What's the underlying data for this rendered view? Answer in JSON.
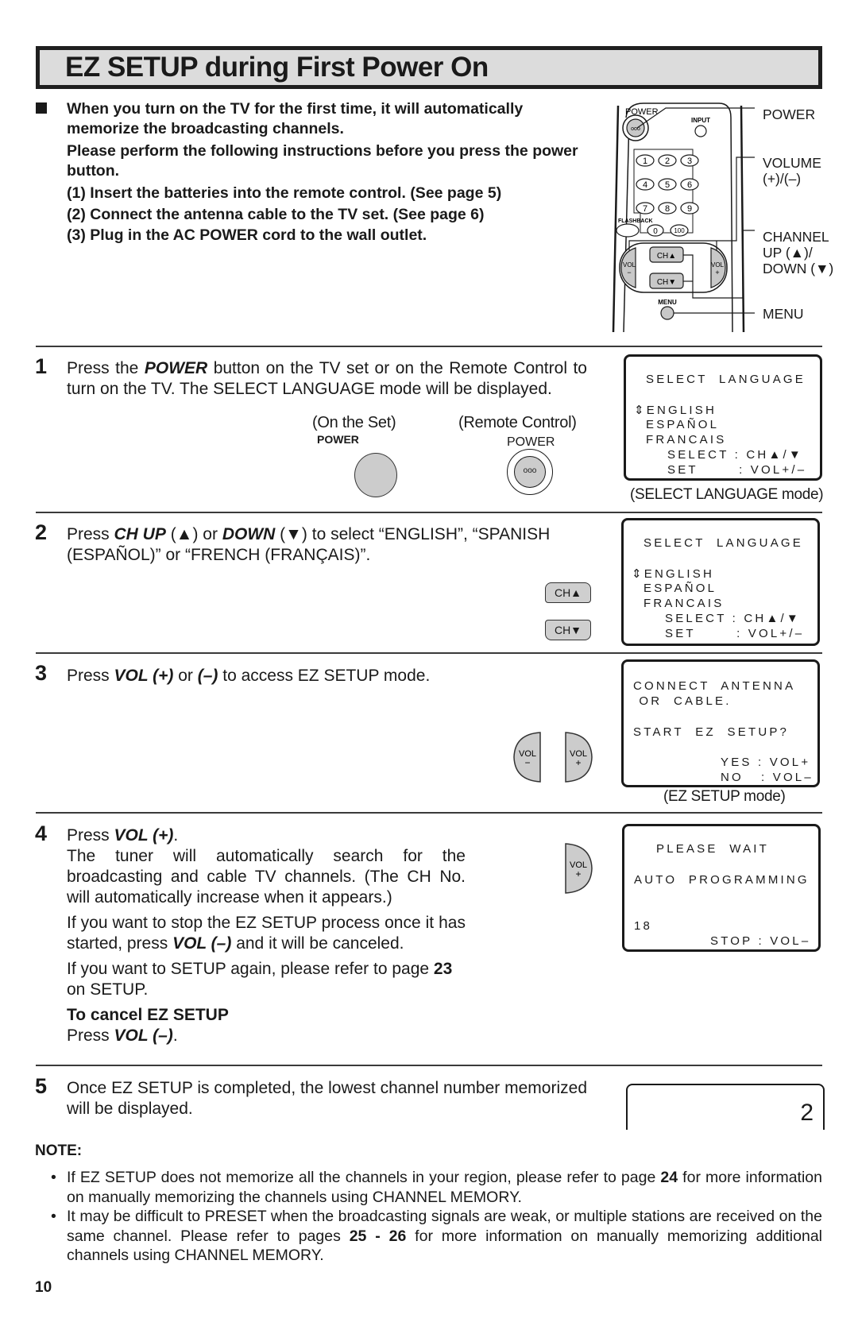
{
  "page": {
    "title": "EZ SETUP during First Power On",
    "page_number": "10"
  },
  "intro": {
    "paragraph1": "When you turn on the TV for the first time, it will automatically memorize the broadcasting channels.",
    "paragraph2": "Please perform the following instructions before you press the power button.",
    "items": [
      "(1) Insert the batteries into the remote control. (See page 5)",
      "(2) Connect the antenna cable to the TV set.  (See page 6)",
      "(3) Plug in the AC POWER cord to the wall outlet."
    ]
  },
  "remote": {
    "buttons": {
      "power": "POWER",
      "input": "INPUT",
      "digits": [
        "1",
        "2",
        "3",
        "4",
        "5",
        "6",
        "7",
        "8",
        "9"
      ],
      "flashback": "FLASHBACK",
      "zero": "0",
      "hundred": "100",
      "ch_up": "CH▲",
      "ch_down": "CH▼",
      "vol_minus": "VOL −",
      "vol_plus": "VOL +",
      "menu": "MENU"
    },
    "callouts": {
      "power": "POWER",
      "volume_line1": "VOLUME",
      "volume_line2": "(+)/(–)",
      "channel_line1": "CHANNEL",
      "channel_line2": "UP (▲)/",
      "channel_line3": "DOWN (▼)",
      "menu": "MENU"
    }
  },
  "steps": [
    {
      "number": "1",
      "text_pre": "Press the ",
      "text_em": "POWER",
      "text_post": " button on the TV set or on the Remote Control to turn on the TV. The SELECT LANGUAGE mode will be displayed.",
      "on_set_caption": "(On the Set)",
      "on_set_label": "POWER",
      "remote_caption": "(Remote Control)",
      "remote_label": "POWER",
      "osd": {
        "lines": [
          "SELECT  LANGUAGE",
          "⇕ENGLISH",
          "ESPAÑOL",
          "FRANCAIS",
          "SELECT : CH▲/▼",
          "SET       : VOL+/–"
        ]
      },
      "osd_caption": "(SELECT LANGUAGE mode)"
    },
    {
      "number": "2",
      "text_pre": "Press ",
      "text_em1": "CH UP",
      "text_mid1": " (▲) or ",
      "text_em2": "DOWN",
      "text_post": " (▼) to select “ENGLISH”, “SPANISH (ESPAÑOL)” or “FRENCH (FRANÇAIS)”.",
      "button_up": "CH▲",
      "button_down": "CH▼",
      "osd": {
        "lines": [
          "SELECT  LANGUAGE",
          "⇕ENGLISH",
          "ESPAÑOL",
          "FRANCAIS",
          "SELECT : CH▲/▼",
          "SET       : VOL+/–"
        ]
      }
    },
    {
      "number": "3",
      "text_pre": "Press ",
      "text_em1": "VOL (+)",
      "text_mid": " or ",
      "text_em2": "(–)",
      "text_post": " to access EZ SETUP mode.",
      "button_minus": "VOL\n−",
      "button_plus": "VOL\n+",
      "osd": {
        "lines": [
          "CONNECT  ANTENNA",
          " OR  CABLE.",
          "START  EZ  SETUP?",
          "YES : VOL+",
          "NO   : VOL–"
        ]
      },
      "osd_caption": "(EZ SETUP mode)"
    },
    {
      "number": "4",
      "line1_pre": "Press ",
      "line1_em": "VOL (+)",
      "line1_post": ".",
      "para1": "The tuner will automatically search for the broadcasting and cable TV channels. (The CH No. will automatically increase when it appears.)",
      "para2_pre": "If you want to stop the EZ SETUP process once it has started, press ",
      "para2_em": "VOL (–)",
      "para2_post": " and it will be canceled.",
      "para3_pre": "If you want to SETUP again, please refer to page ",
      "para3_bold": "23",
      "para3_post": " on SETUP.",
      "cancel_heading": "To cancel EZ SETUP",
      "cancel_pre": "Press ",
      "cancel_em": "VOL (–)",
      "cancel_post": ".",
      "button_plus": "VOL\n+",
      "osd": {
        "lines": [
          "PLEASE  WAIT",
          "AUTO  PROGRAMMING",
          "18",
          "STOP : VOL–"
        ]
      }
    },
    {
      "number": "5",
      "text": "Once EZ SETUP is completed, the lowest channel number memorized will be displayed.",
      "display_value": "2"
    }
  ],
  "note": {
    "heading": "NOTE:",
    "items": [
      {
        "pre": "If EZ SETUP does not memorize all the channels in your region, please refer to page ",
        "bold": "24",
        "post": " for more information on manually memorizing the channels using CHANNEL MEMORY."
      },
      {
        "pre": "It may be difficult to PRESET when the broadcasting signals are weak, or multiple stations are received on the same channel. Please refer to pages ",
        "bold": "25 - 26",
        "post": " for more information on manually memorizing additional channels using CHANNEL MEMORY."
      }
    ]
  }
}
